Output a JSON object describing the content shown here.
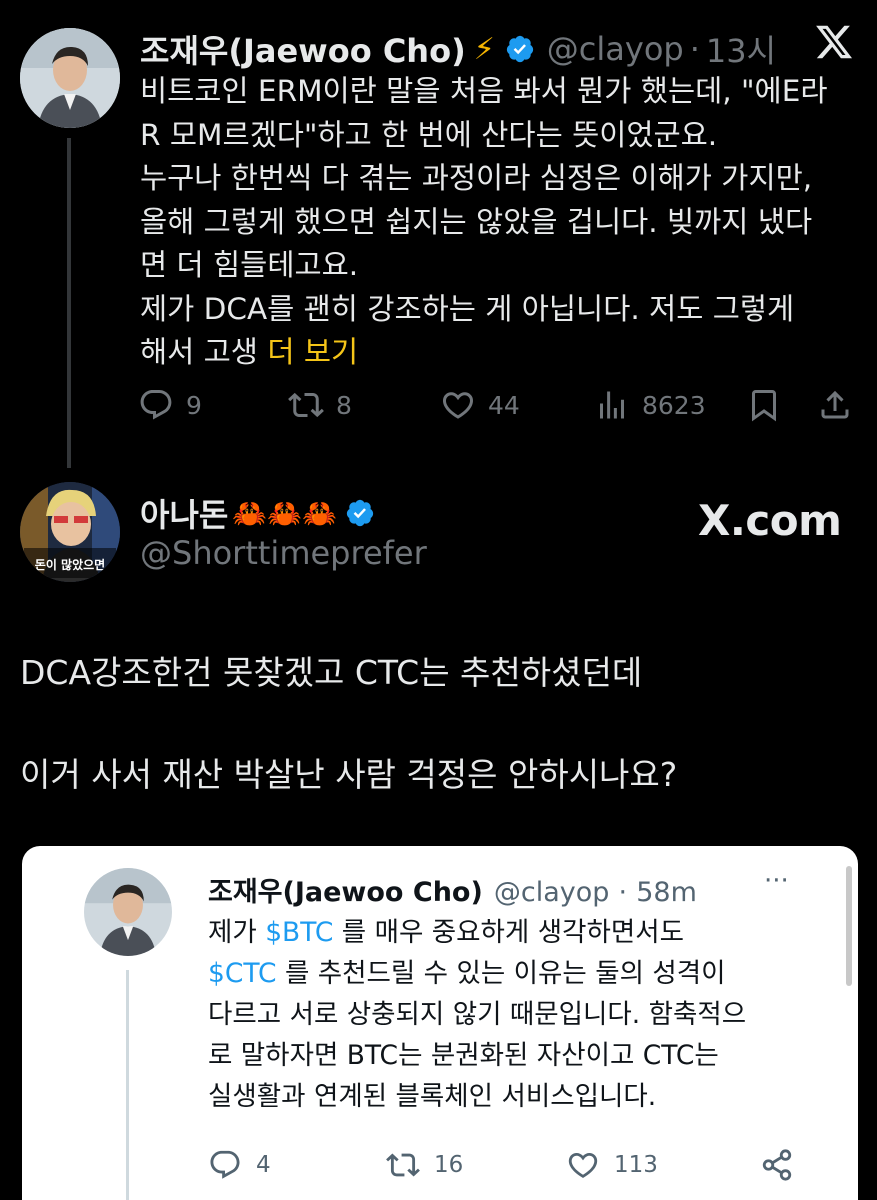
{
  "tweet1": {
    "name": "조재우(Jaewoo Cho)",
    "lightning": "⚡",
    "handle": "@clayop",
    "separator": "·",
    "time": "13시",
    "body": "비트코인 ERM이란 말을 처음 봐서 뭔가 했는데, \"에E라\nR 모M르겠다\"하고 한 번에 산다는 뜻이었군요.\n누구나 한번씩 다 겪는 과정이라 심정은 이해가 가지만,\n올해 그렇게 했으면 쉽지는 않았을 겁니다. 빚까지 냈다\n면 더 힘들테고요.\n제가 DCA를 괜히 강조하는 게 아닙니다. 저도 그렇게\n해서 고생 ",
    "more": "더 보기",
    "replies": "9",
    "retweets": "8",
    "likes": "44",
    "views": "8623"
  },
  "tweet2": {
    "name": "아나돈",
    "crabs": "🦀🦀🦀",
    "handle": "@Shorttimeprefer",
    "watermark": "X.com",
    "avatar_caption": "돈이 많았으면",
    "line1": "DCA강조한건 못찾겠고 CTC는 추천하셨던데",
    "line2": "이거 사서 재산 박살난 사람 걱정은 안하시나요?"
  },
  "quoted": {
    "name": "조재우(Jaewoo Cho)",
    "handle": "@clayop",
    "separator": "·",
    "time": "58m",
    "more_dots": "···",
    "l1_a": "제가 ",
    "l1_cash": "$BTC",
    "l1_b": " 를 매우 중요하게 생각하면서도",
    "l2_cash": "$CTC",
    "l2_b": " 를 추천드릴 수 있는 이유는 둘의 성격이",
    "l3": "다르고 서로 상충되지 않기 때문입니다. 함축적으",
    "l4": "로 말하자면 BTC는 분권화된 자산이고 CTC는",
    "l5": "실생활과 연계된 블록체인 서비스입니다.",
    "replies": "4",
    "retweets": "16",
    "likes": "113"
  },
  "colors": {
    "background": "#000000",
    "text": "#e7e9ea",
    "muted": "#71767b",
    "verified": "#1d9bf0",
    "more_link": "#f5c518",
    "lightning": "#f5b400"
  }
}
